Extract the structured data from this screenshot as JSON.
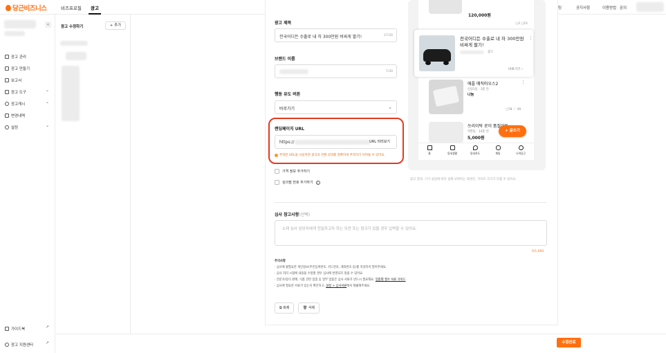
{
  "app": {
    "logo": "당근비즈니스",
    "brand_color": "#ff6f0f"
  },
  "topnav": {
    "items": [
      "비즈프로필",
      "광고"
    ],
    "right": [
      "알림",
      "채팅",
      "공지사항",
      "이용방법",
      "문의"
    ]
  },
  "sidebar": {
    "items": [
      "광고 관리",
      "광고 만들기",
      "보고서",
      "광고 도구",
      "광고캐시",
      "변경내역",
      "설정"
    ],
    "bottom": [
      "가이드북",
      "광고 지원센터"
    ]
  },
  "col2": {
    "header": "광고 수정하기",
    "add_button": "+ 추가"
  },
  "form": {
    "ad_title_label": "광고 제목",
    "ad_title_value": "전국어디든 수출로 내 차 300만원 비싸게 팔기!",
    "ad_title_count": "27/30",
    "brand_label": "브랜드 이름",
    "brand_count": "7/30",
    "cta_label": "행동 유도 버튼",
    "cta_value": "바로가기",
    "landing_label": "랜딩페이지 URL",
    "landing_value": "https://",
    "url_preview": "URL 미리보기",
    "warning": "추적된 URL을 사용하면 광고의 전환 성과를 정확하게 추적하기 어려울 수 있어요.",
    "chk_price": "가격 정보 추가하기",
    "chk_phone": "심의필 번호 추가하기",
    "review_label": "심사 참고사항",
    "review_optional": "(선택)",
    "review_placeholder": "소재 심사 담당자에게 전달하고자 하는 의견 또는 링크가 있을 경우 입력할 수 있어요.",
    "review_count": "0/1,000",
    "notes_title": "주의사항",
    "notes": [
      "· 심사에 불필요한 개인정보(주민등록번호, 카드번호, 계좌번호 등)를 작성하지 말아주세요.",
      "· 심사 처리 시점에 내용을 수정할 경우 심사에 반영되지 않을 수 있어요.",
      "· 전문가/정식 판매, 식품 관련 업종 등 일부 업종은 심사 서류가 반드시 필요해요.",
      "· 심사에 필요한 서류가 있는지 확인하고,"
    ],
    "notes_link1": "업종별 필수 서류 가이드",
    "notes_link2": "설정 > 심사서류",
    "notes_tail": "에서 제출해주세요.",
    "copy_btn": "복제",
    "delete_btn": "삭제"
  },
  "preview": {
    "top_price": "120,000원",
    "ad_title": "전국어디든 수출로 내 차 300만원 비싸게 팔기!",
    "ad_tag": "광고",
    "ad_link": "바로가기",
    "item1_title": "애플 매직마우스2",
    "item1_meta": "신당1동 · 3분 전",
    "item1_price": "나눔",
    "item1_stat": "78 ♡ 39",
    "item2_title": "쓰리이탁 로이 품질이든",
    "item2_meta": "역촌동 · 14분 전",
    "item2_price": "5,000원",
    "fab": "+ 글쓰기",
    "tabs": [
      "홈",
      "동네생활",
      "동네지도",
      "채팅",
      "나의당근"
    ],
    "note": "광고 결과, 기기 설정에 따라 실제 보여지는 화면은, 가이즈 크기가 다를 수 있어요."
  },
  "submit": "수정완료"
}
